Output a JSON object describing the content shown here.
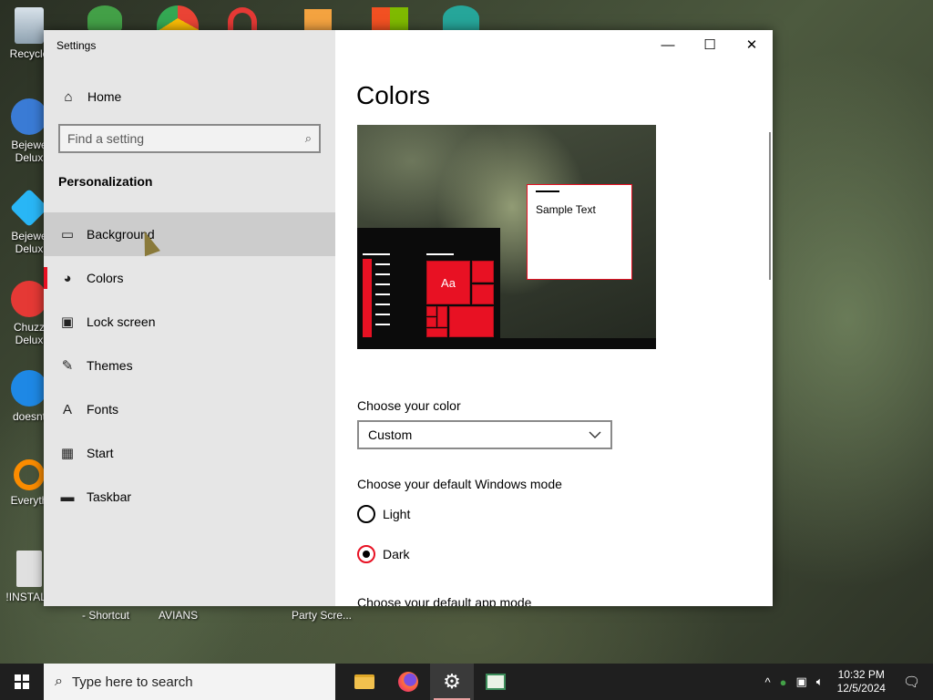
{
  "desktop": {
    "icons": [
      {
        "label": "Recycle",
        "color": "#c9d6e0"
      },
      {
        "label": "Bejewe Delux",
        "color": "#3a7bd5"
      },
      {
        "label": "Bejewe Delux",
        "color": "#29b6f6"
      },
      {
        "label": "Chuzz Delux",
        "color": "#e53935"
      },
      {
        "label": "doesnt",
        "color": "#1e88e5"
      },
      {
        "label": "Everyth",
        "color": "#fb8c00"
      },
      {
        "label": "!INSTALL",
        "color": "#e0e0e0"
      }
    ],
    "bottom_labels": [
      "- Shortcut",
      "AVIANS",
      "Party Scre..."
    ]
  },
  "window": {
    "title": "Settings",
    "caption": {
      "minimize": "—",
      "maximize": "☐",
      "close": "✕"
    }
  },
  "sidebar": {
    "home_label": "Home",
    "search_placeholder": "Find a setting",
    "section": "Personalization",
    "items": [
      {
        "label": "Background",
        "icon": "image-icon",
        "glyph": "▭"
      },
      {
        "label": "Colors",
        "icon": "palette-icon",
        "glyph": "◕"
      },
      {
        "label": "Lock screen",
        "icon": "lock-screen-icon",
        "glyph": "▣"
      },
      {
        "label": "Themes",
        "icon": "themes-icon",
        "glyph": "✎"
      },
      {
        "label": "Fonts",
        "icon": "fonts-icon",
        "glyph": "A"
      },
      {
        "label": "Start",
        "icon": "start-icon",
        "glyph": "▦"
      },
      {
        "label": "Taskbar",
        "icon": "taskbar-icon",
        "glyph": "▬"
      }
    ]
  },
  "content": {
    "title": "Colors",
    "preview": {
      "sample_text": "Sample Text",
      "tile_text": "Aa",
      "accent": "#e81123"
    },
    "choose_color_label": "Choose your color",
    "choose_color_value": "Custom",
    "windows_mode_label": "Choose your default Windows mode",
    "mode_options": [
      {
        "label": "Light",
        "checked": false
      },
      {
        "label": "Dark",
        "checked": true
      }
    ],
    "app_mode_label": "Choose your default app mode"
  },
  "taskbar": {
    "search_text": "Type here to search",
    "time": "10:32 PM",
    "date": "12/5/2024"
  }
}
